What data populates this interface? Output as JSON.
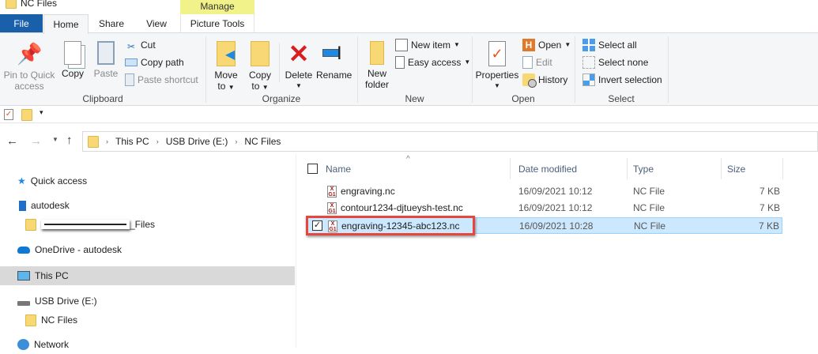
{
  "window": {
    "title": "NC Files"
  },
  "tabs": {
    "file": "File",
    "home": "Home",
    "share": "Share",
    "view": "View",
    "manage_header": "Manage",
    "picture_tools": "Picture Tools"
  },
  "ribbon": {
    "clipboard": {
      "label": "Clipboard",
      "pin": "Pin to Quick",
      "pin2": "access",
      "copy": "Copy",
      "paste": "Paste",
      "cut": "Cut",
      "copy_path": "Copy path",
      "paste_shortcut": "Paste shortcut"
    },
    "organize": {
      "label": "Organize",
      "move_to": "Move",
      "move_to2": "to",
      "copy_to": "Copy",
      "copy_to2": "to",
      "delete": "Delete",
      "rename": "Rename"
    },
    "new": {
      "label": "New",
      "new_folder": "New",
      "new_folder2": "folder",
      "new_item": "New item",
      "easy_access": "Easy access"
    },
    "open": {
      "label": "Open",
      "properties": "Properties",
      "open": "Open",
      "edit": "Edit",
      "history": "History"
    },
    "select": {
      "label": "Select",
      "select_all": "Select all",
      "select_none": "Select none",
      "invert": "Invert selection"
    }
  },
  "breadcrumb": [
    "This PC",
    "USB Drive (E:)",
    "NC Files"
  ],
  "nav": {
    "quick_access": "Quick access",
    "autodesk": "autodesk",
    "files": "_Files",
    "onedrive": "OneDrive - autodesk",
    "this_pc": "This PC",
    "usb": "USB Drive (E:)",
    "nc_files": "NC Files",
    "network": "Network"
  },
  "columns": {
    "name": "Name",
    "date": "Date modified",
    "type": "Type",
    "size": "Size"
  },
  "files": [
    {
      "name": "engraving.nc",
      "date": "16/09/2021 10:12",
      "type": "NC File",
      "size": "7 KB"
    },
    {
      "name": "contour1234-djtueysh-test.nc",
      "date": "16/09/2021 10:12",
      "type": "NC File",
      "size": "7 KB"
    },
    {
      "name": "engraving-12345-abc123.nc",
      "date": "16/09/2021 10:28",
      "type": "NC File",
      "size": "7 KB"
    }
  ],
  "colors": {
    "accent": "#0063b1",
    "selected_row": "#cce8ff",
    "highlight_box": "#e8453c",
    "manage": "#f2f28a"
  }
}
